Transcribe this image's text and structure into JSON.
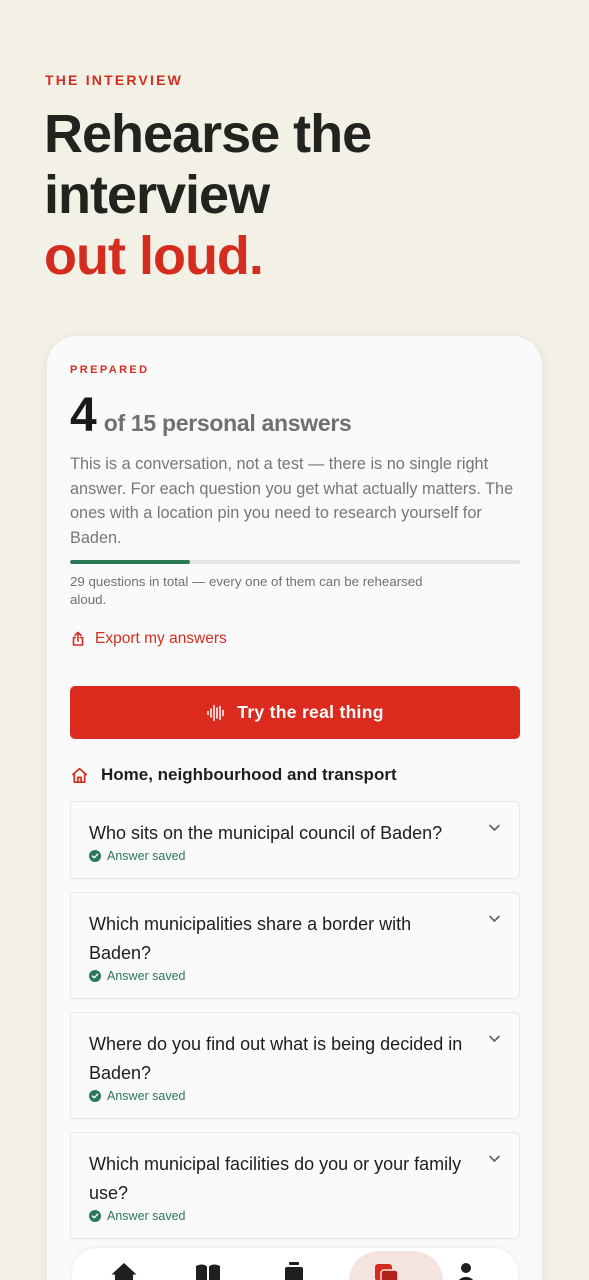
{
  "header": {
    "eyebrow": "THE INTERVIEW",
    "headline_line1": "Rehearse the",
    "headline_line2": "interview",
    "headline_accent": "out loud."
  },
  "progress_card": {
    "label": "PREPARED",
    "count": "4",
    "count_rest": "of 15 personal answers",
    "description": "This is a conversation, not a test — there is no single right answer. For each question you get what actually matters. The ones with a location pin you need to research yourself for Baden.",
    "progress_fraction": 0.267,
    "note": "29 questions in total — every one of them can be rehearsed aloud."
  },
  "actions": {
    "export_label": "Export my answers",
    "cta_label": "Try the real thing"
  },
  "section": {
    "title": "Home, neighbourhood and transport",
    "questions": [
      {
        "text": "Who sits on the municipal council of Baden?",
        "status": "Answer saved"
      },
      {
        "text": "Which municipalities share a border with Baden?",
        "status": "Answer saved"
      },
      {
        "text": "Where do you find out what is being decided in Baden?",
        "status": "Answer saved"
      },
      {
        "text": "Which municipal facilities do you or your family use?",
        "status": "Answer saved"
      }
    ]
  },
  "tabbar": {
    "tabs": [
      {
        "icon": "home-icon"
      },
      {
        "icon": "book-icon"
      },
      {
        "icon": "document-icon"
      },
      {
        "icon": "chat-icon",
        "active": true
      },
      {
        "icon": "person-icon"
      }
    ]
  },
  "colors": {
    "accent": "#d42d1f",
    "button": "#db2b1e",
    "success": "#2b7a55",
    "background": "#f3f1e6"
  }
}
